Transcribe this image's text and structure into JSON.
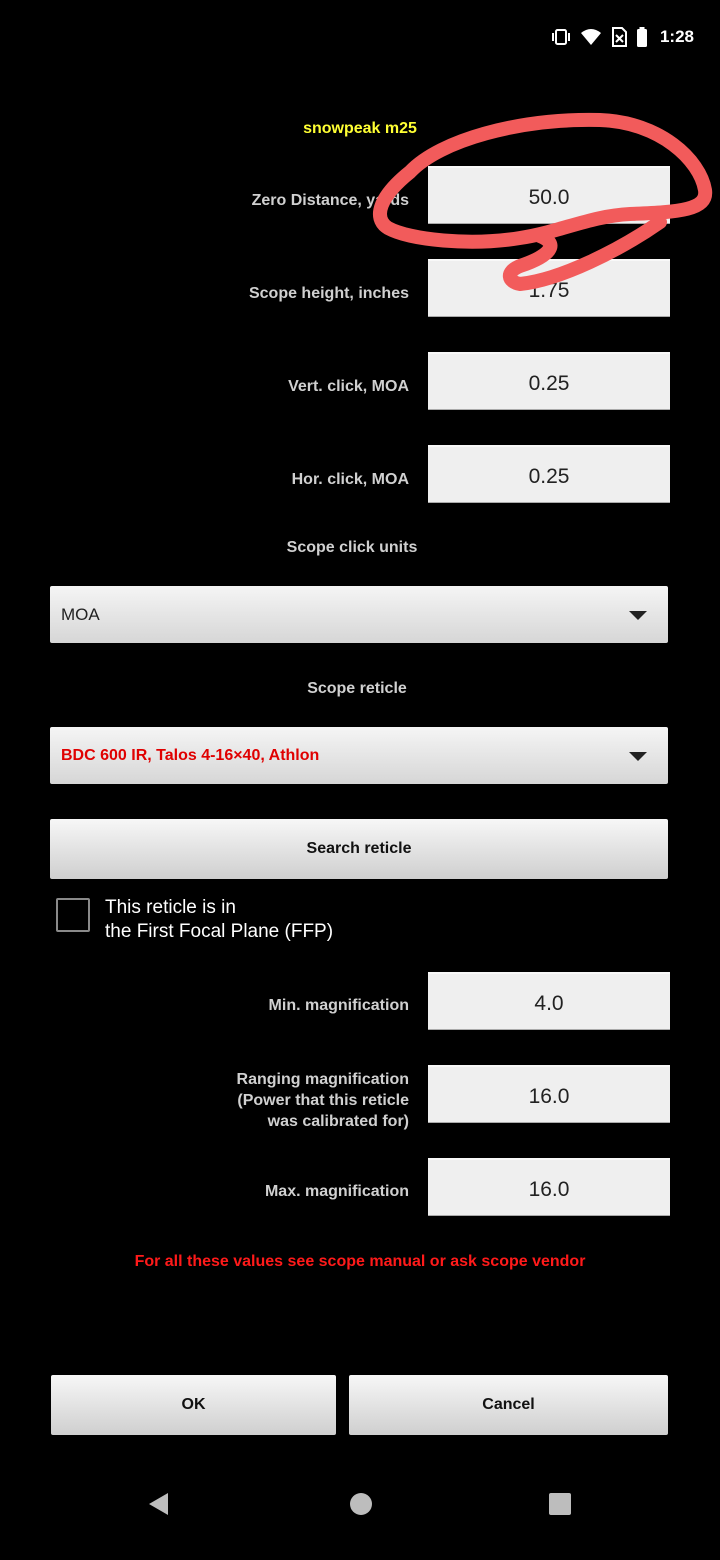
{
  "status_bar": {
    "time": "1:28",
    "icons": [
      "vibrate-icon",
      "wifi-icon",
      "no-sim-icon",
      "battery-icon"
    ]
  },
  "profile_name": "snowpeak m25",
  "fields": {
    "zero_distance": {
      "label": "Zero Distance, yards",
      "value": "50.0"
    },
    "scope_height": {
      "label": "Scope height, inches",
      "value": "1.75"
    },
    "vert_click": {
      "label": "Vert. click, MOA",
      "value": "0.25"
    },
    "hor_click": {
      "label": "Hor. click, MOA",
      "value": "0.25"
    }
  },
  "click_units": {
    "label": "Scope click units",
    "selected": "MOA"
  },
  "reticle": {
    "label": "Scope reticle",
    "selected": "BDC 600 IR, Talos 4-16×40, Athlon"
  },
  "search_button": "Search reticle",
  "ffp": {
    "line1": "This reticle is in",
    "line2": "the First Focal Plane (FFP)",
    "checked": false
  },
  "magnification": {
    "min": {
      "label": "Min. magnification",
      "value": "4.0"
    },
    "ranging": {
      "line1": "Ranging magnification",
      "line2": "(Power that this reticle",
      "line3": "was calibrated for)",
      "value": "16.0"
    },
    "max": {
      "label": "Max. magnification",
      "value": "16.0"
    }
  },
  "warning": "For all these values see scope manual or ask scope vendor",
  "buttons": {
    "ok": "OK",
    "cancel": "Cancel"
  },
  "colors": {
    "title": "#ffff33",
    "warning": "#ff1a1a",
    "annotation": "#f25b5b"
  }
}
